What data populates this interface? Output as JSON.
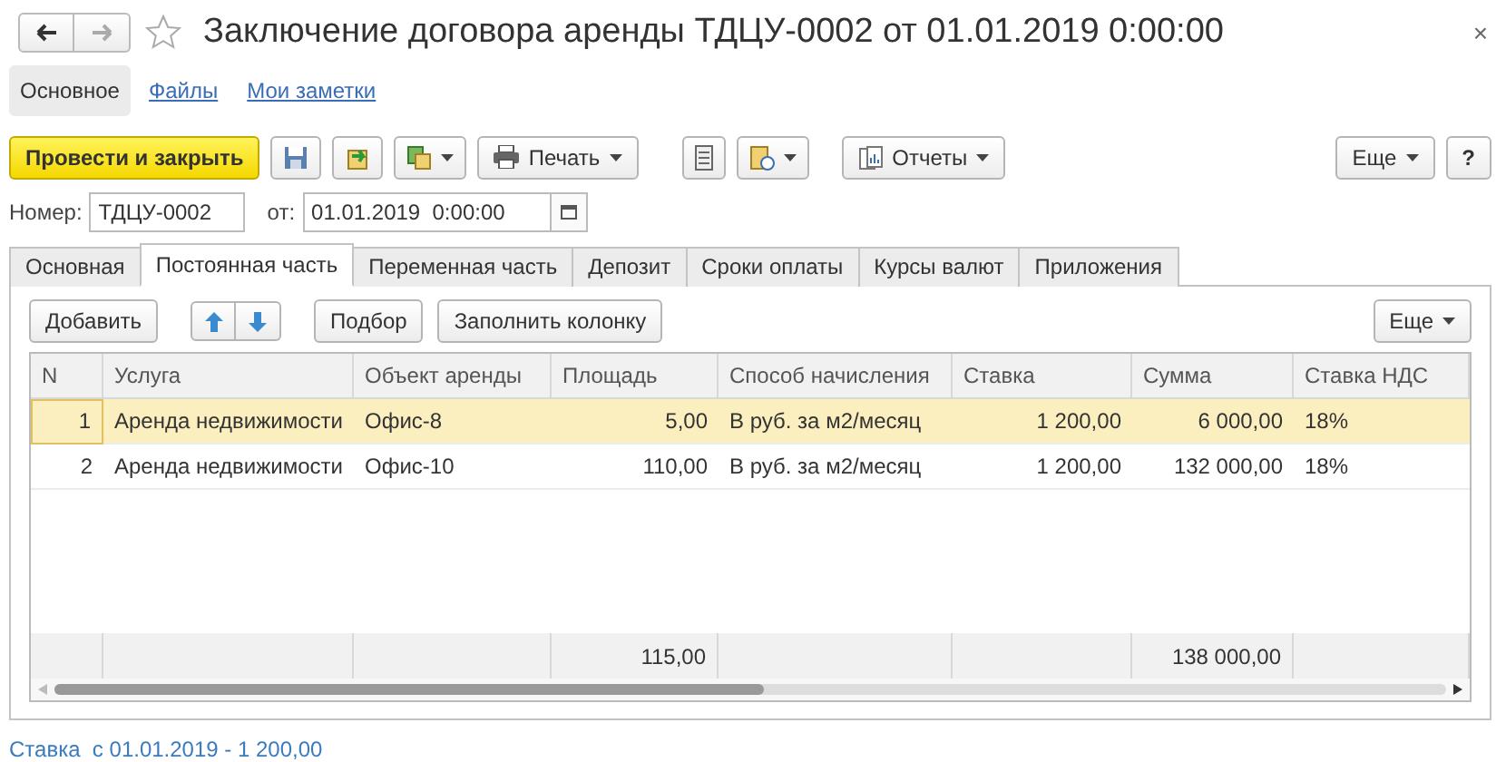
{
  "window": {
    "title": "Заключение договора аренды ТДЦУ-0002 от 01.01.2019 0:00:00",
    "close": "×"
  },
  "nav_tabs": [
    {
      "label": "Основное",
      "selected": true
    },
    {
      "label": "Файлы",
      "selected": false
    },
    {
      "label": "Мои заметки",
      "selected": false
    }
  ],
  "toolbar": {
    "primary": "Провести и закрыть",
    "print": "Печать",
    "reports": "Отчеты",
    "more": "Еще",
    "help": "?"
  },
  "fields": {
    "number_label": "Номер:",
    "number": "ТДЦУ-0002",
    "date_label": "от:",
    "date": "01.01.2019  0:00:00"
  },
  "tabs": [
    {
      "label": "Основная",
      "selected": false
    },
    {
      "label": "Постоянная часть",
      "selected": true
    },
    {
      "label": "Переменная часть",
      "selected": false
    },
    {
      "label": "Депозит",
      "selected": false
    },
    {
      "label": "Сроки оплаты",
      "selected": false
    },
    {
      "label": "Курсы валют",
      "selected": false
    },
    {
      "label": "Приложения",
      "selected": false
    }
  ],
  "table_toolbar": {
    "add": "Добавить",
    "pick": "Подбор",
    "fill": "Заполнить колонку",
    "more": "Еще"
  },
  "table": {
    "columns": [
      {
        "label": "N",
        "kind": "number"
      },
      {
        "label": "Услуга",
        "kind": "text"
      },
      {
        "label": "Объект аренды",
        "kind": "text"
      },
      {
        "label": "Площадь",
        "kind": "number",
        "total": "115,00"
      },
      {
        "label": "Способ начисления",
        "kind": "text"
      },
      {
        "label": "Ставка",
        "kind": "number"
      },
      {
        "label": "Сумма",
        "kind": "number",
        "total": "138 000,00"
      },
      {
        "label": "Ставка НДС",
        "kind": "text"
      }
    ],
    "rows": [
      {
        "selected": true,
        "cells": [
          "1",
          "Аренда недвижимости",
          "Офис-8",
          "5,00",
          "В руб. за м2/месяц",
          "1 200,00",
          "6 000,00",
          "18%"
        ]
      },
      {
        "selected": false,
        "cells": [
          "2",
          "Аренда недвижимости",
          "Офис-10",
          "110,00",
          "В руб. за м2/месяц",
          "1 200,00",
          "132 000,00",
          "18%"
        ]
      }
    ]
  },
  "footer_link": "Ставка  с 01.01.2019 - 1 200,00"
}
